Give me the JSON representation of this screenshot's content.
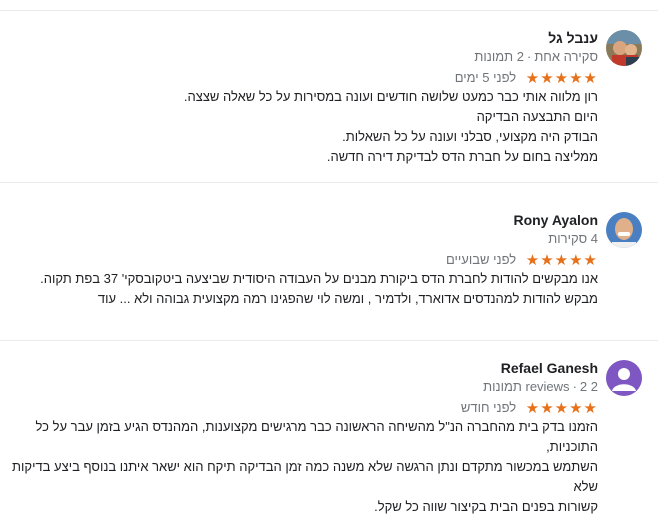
{
  "reviews": [
    {
      "name": "ענבל גל",
      "reviews_count": "סקירה אחת",
      "photos_count": "2 תמונות",
      "stars": "★★★★★",
      "when": "לפני 5 ימים",
      "lines": [
        "רון מלווה אותי כבר כמעט שלושה חודשים ועונה במסירות על כל שאלה שצצה.",
        "היום התבצעה הבדיקה",
        "הבודק היה מקצועי, סבלני ועונה על כל השאלות.",
        "ממליצה בחום על חברת הדס לבדיקת דירה חדשה."
      ]
    },
    {
      "name": "Rony Ayalon",
      "reviews_count": "4 סקירות",
      "stars": "★★★★★",
      "when": "לפני שבועיים",
      "lines": [
        "אנו מבקשים להודות לחברת הדס ביקורת מבנים על העבודה היסודית שביצעה ביטקובסקי' 37 בפת תקוה.",
        "מבקש להודות למהנדסים  אדוארד, ולדמיר , ומשה לוי שהפגינו רמה מקצועית גבוהה ולא ..."
      ],
      "more_label": "עוד"
    },
    {
      "name": "Refael Ganesh",
      "reviews_count": "2 reviews",
      "photos_count": "2 תמונות",
      "stars": "★★★★★",
      "when": "לפני חודש",
      "lines": [
        "הזמנו בדק בית מהחברה הנ\"ל מהשיחה הראשונה כבר מרגישים מקצוענות, המהנדס הגיע בזמן עבר על כל התוכניות,",
        "השתמש במכשור מתקדם ונתן הרגשה שלא משנה כמה זמן הבדיקה תיקח הוא ישאר איתנו בנוסף ביצע בדיקות שלא",
        "קשורות בפנים הבית בקיצור שווה כל שקל."
      ]
    }
  ],
  "colors": {
    "star": "#e7711b",
    "meta": "#70757a",
    "text": "#202124",
    "divider": "#ebebeb",
    "avatar_purple": "#7e57c2"
  }
}
